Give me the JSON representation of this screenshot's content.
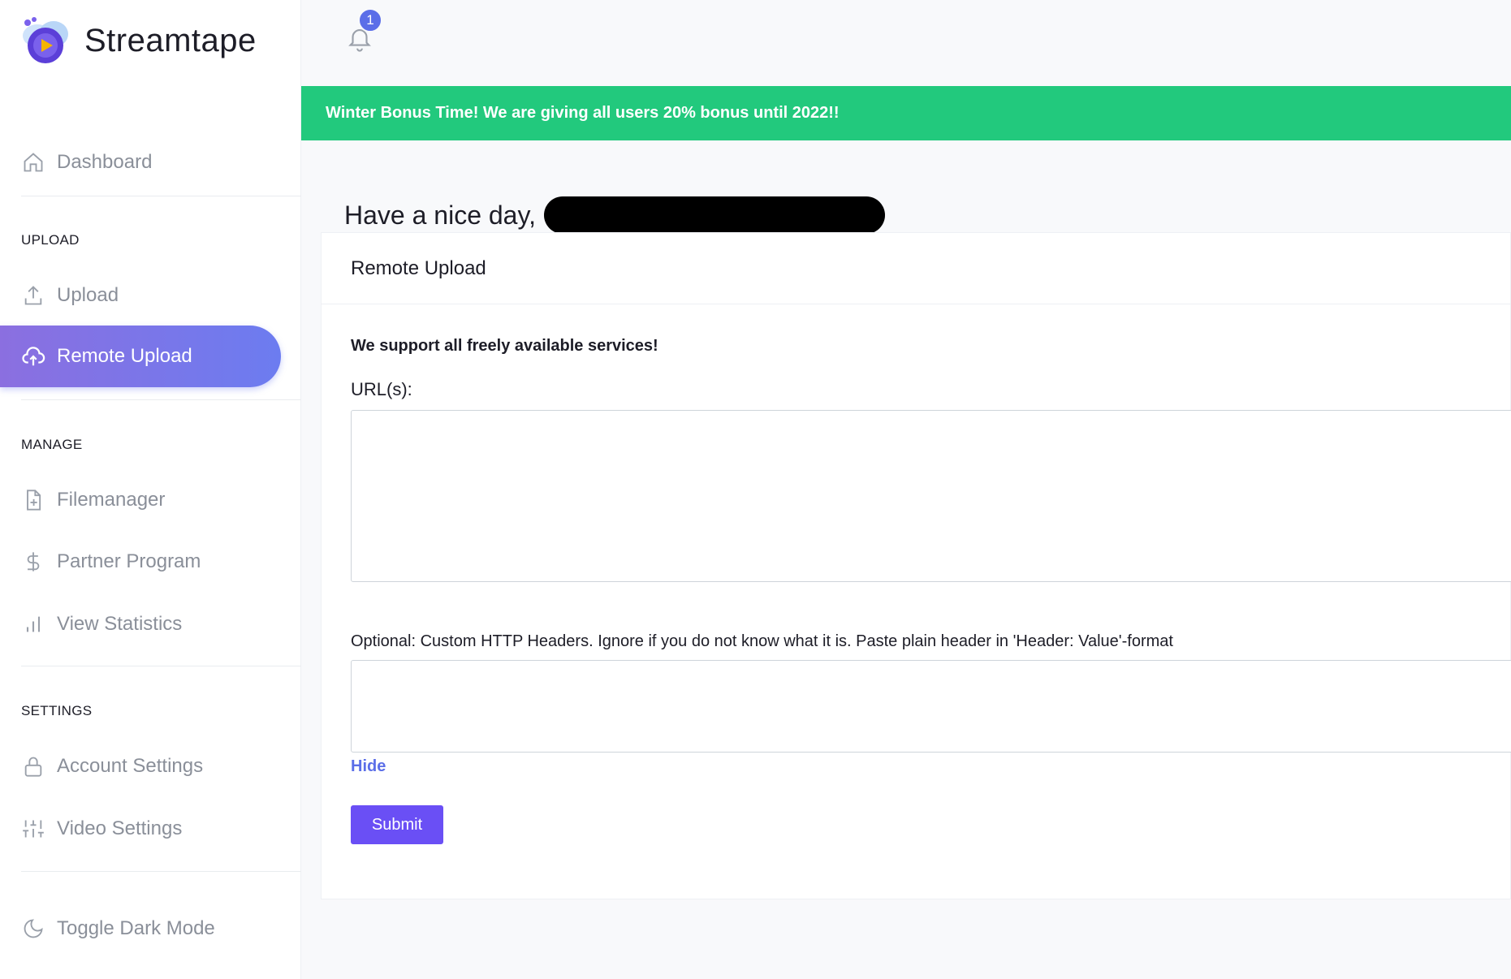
{
  "brand": {
    "name": "Streamtape"
  },
  "sidebar": {
    "dashboard": "Dashboard",
    "sections": {
      "upload": "UPLOAD",
      "manage": "MANAGE",
      "settings": "SETTINGS"
    },
    "items": {
      "upload": "Upload",
      "remote_upload": "Remote Upload",
      "filemanager": "Filemanager",
      "partner_program": "Partner Program",
      "view_statistics": "View Statistics",
      "account_settings": "Account Settings",
      "video_settings": "Video Settings",
      "toggle_dark_mode": "Toggle Dark Mode"
    },
    "active_item": "remote_upload"
  },
  "topbar": {
    "notification_count": "1"
  },
  "banner": {
    "text": "Winter Bonus Time! We are giving all users 20% bonus until 2022!!"
  },
  "greeting": {
    "text": "Have a nice day,"
  },
  "card": {
    "title": "Remote Upload",
    "support_text": "We support all freely available services!",
    "urls_label": "URL(s):",
    "urls_value": "",
    "headers_label": "Optional: Custom HTTP Headers. Ignore if you do not know what it is. Paste plain header in 'Header: Value'-format",
    "headers_value": "",
    "hide_link": "Hide",
    "submit_label": "Submit"
  },
  "colors": {
    "accent": "#6a4ff5",
    "banner_green": "#22c97d",
    "nav_active_start": "#8b6fe0",
    "nav_active_end": "#6c7cf0",
    "badge_blue": "#5b6ee8"
  }
}
